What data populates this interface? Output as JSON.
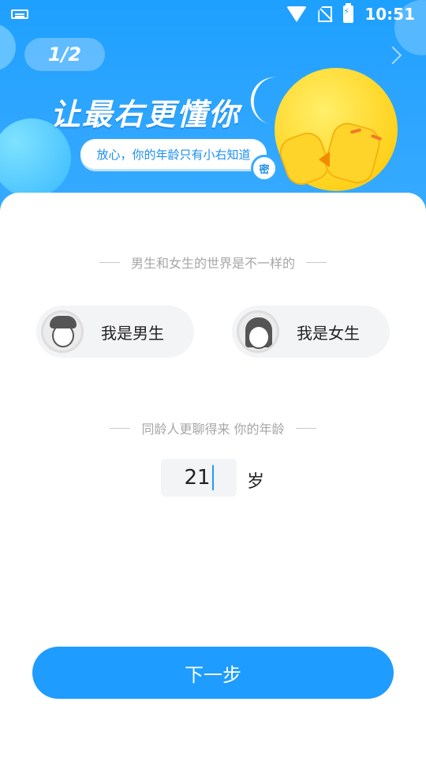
{
  "status_bar": {
    "time": "10:51",
    "icons": [
      "keyboard-icon",
      "wifi-icon",
      "no-sim-icon",
      "battery-charging-icon"
    ]
  },
  "header": {
    "step": "1/2",
    "headline": "让最右更懂你",
    "bubble_text": "放心，你的年龄只有小右知道",
    "badge_text": "密",
    "next_icon": "chevron-right-icon",
    "background_color": "#1ea0ff"
  },
  "gender": {
    "section_title": "男生和女生的世界是不一样的",
    "options": [
      {
        "label": "我是男生",
        "icon": "male-avatar-icon"
      },
      {
        "label": "我是女生",
        "icon": "female-avatar-icon"
      }
    ]
  },
  "age": {
    "section_title": "同龄人更聊得来 你的年龄",
    "value": "21",
    "unit": "岁"
  },
  "footer": {
    "next_label": "下一步",
    "accent_color": "#1e9cff"
  }
}
